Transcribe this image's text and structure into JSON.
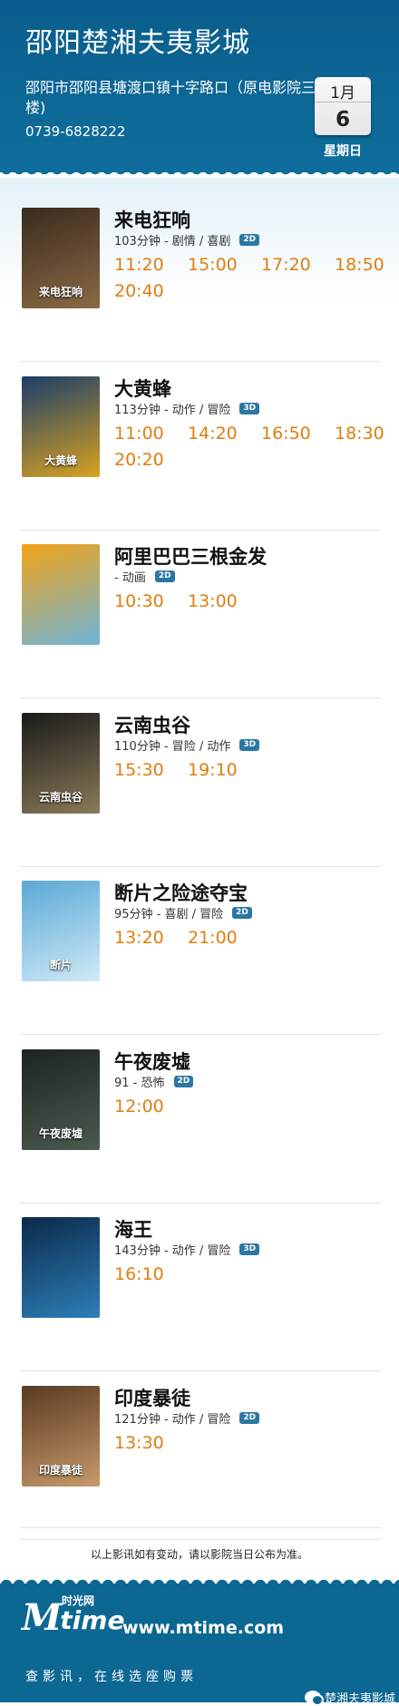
{
  "header": {
    "cinema_name": "邵阳楚湘夫夷影城",
    "address": "邵阳市邵阳县塘渡口镇十字路口（原电影院三楼)",
    "phone": "0739-6828222",
    "month": "1月",
    "day": "6",
    "weekday": "星期日"
  },
  "movies": [
    {
      "title": "来电狂响",
      "meta": "103分钟 - 剧情 / 喜剧",
      "format": "2D",
      "poster_text": "来电狂响",
      "poster_colors": [
        "#3b2a1e",
        "#8a6a45"
      ],
      "times": [
        "11:20",
        "15:00",
        "17:20",
        "18:50",
        "20:40"
      ]
    },
    {
      "title": "大黄蜂",
      "meta": "113分钟 - 动作 / 冒险",
      "format": "3D",
      "poster_text": "大黄蜂",
      "poster_colors": [
        "#1b3d6b",
        "#d8a21f"
      ],
      "times": [
        "11:00",
        "14:20",
        "16:50",
        "18:30",
        "20:20"
      ]
    },
    {
      "title": "阿里巴巴三根金发",
      "meta": " - 动画",
      "format": "2D",
      "poster_text": "",
      "poster_colors": [
        "#f2a417",
        "#6fb4d8"
      ],
      "times": [
        "10:30",
        "13:00"
      ]
    },
    {
      "title": "云南虫谷",
      "meta": "110分钟 - 冒险 / 动作",
      "format": "3D",
      "poster_text": "云南虫谷",
      "poster_colors": [
        "#1a1a1a",
        "#8a7a58"
      ],
      "times": [
        "15:30",
        "19:10"
      ]
    },
    {
      "title": "断片之险途夺宝",
      "meta": "95分钟 - 喜剧 / 冒险",
      "format": "2D",
      "poster_text": "断片",
      "poster_colors": [
        "#5aa9d6",
        "#cfe9f6"
      ],
      "times": [
        "13:20",
        "21:00"
      ]
    },
    {
      "title": "午夜废墟",
      "meta": "91 - 恐怖",
      "format": "2D",
      "poster_text": "午夜废墟",
      "poster_colors": [
        "#1c2421",
        "#4c5a4f"
      ],
      "times": [
        "12:00"
      ]
    },
    {
      "title": "海王",
      "meta": "143分钟 - 动作 / 冒险",
      "format": "3D",
      "poster_text": "",
      "poster_colors": [
        "#0b2a4a",
        "#2d7fb8"
      ],
      "times": [
        "16:10"
      ]
    },
    {
      "title": "印度暴徒",
      "meta": "121分钟 - 动作 / 冒险",
      "format": "2D",
      "poster_text": "印度暴徒",
      "poster_colors": [
        "#5a3a22",
        "#c79a6a"
      ],
      "times": [
        "13:30"
      ]
    }
  ],
  "notice": "以上影讯如有变动，请以影院当日公布为准。",
  "footer": {
    "logo_word": "time",
    "logo_m": "M",
    "logo_cn": "时光网",
    "site": "www.mtime.com",
    "slogan": "查影讯，在线选座购票",
    "wechat_account": "楚湘夫夷影城"
  },
  "colors": {
    "header_blue": "#0d6896",
    "showtime_orange": "#e07d10",
    "badge_blue": "#2a77a3"
  }
}
